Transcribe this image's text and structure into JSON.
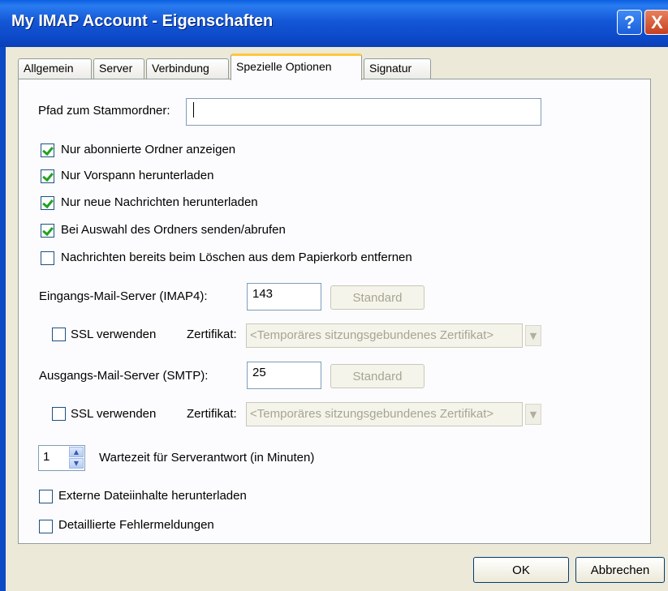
{
  "window": {
    "title": "My IMAP Account - Eigenschaften",
    "help_label": "?",
    "close_label": "X"
  },
  "tabs": [
    {
      "label": "Allgemein"
    },
    {
      "label": "Server"
    },
    {
      "label": "Verbindung"
    },
    {
      "label": "Spezielle Optionen"
    },
    {
      "label": "Signatur"
    }
  ],
  "root_folder": {
    "label": "Pfad zum Stammordner:",
    "value": ""
  },
  "checkboxes": [
    {
      "label": "Nur abonnierte Ordner anzeigen",
      "checked": true
    },
    {
      "label": "Nur Vorspann herunterladen",
      "checked": true
    },
    {
      "label": "Nur neue Nachrichten herunterladen",
      "checked": true
    },
    {
      "label": "Bei Auswahl des Ordners senden/abrufen",
      "checked": true
    },
    {
      "label": "Nachrichten bereits beim Löschen aus dem Papierkorb entfernen",
      "checked": false
    }
  ],
  "incoming": {
    "label": "Eingangs-Mail-Server (IMAP4):",
    "port": "143",
    "standard_label": "Standard",
    "ssl_label": "SSL verwenden",
    "ssl_checked": false,
    "cert_label": "Zertifikat:",
    "cert_value": "<Temporäres sitzungsgebundenes Zertifikat>"
  },
  "outgoing": {
    "label": "Ausgangs-Mail-Server (SMTP):",
    "port": "25",
    "standard_label": "Standard",
    "ssl_label": "SSL verwenden",
    "ssl_checked": false,
    "cert_label": "Zertifikat:",
    "cert_value": "<Temporäres sitzungsgebundenes Zertifikat>"
  },
  "timeout": {
    "value": "1",
    "label": "Wartezeit für Serverantwort (in Minuten)"
  },
  "extra_checkboxes": [
    {
      "label": "Externe Dateiinhalte herunterladen",
      "checked": false
    },
    {
      "label": "Detaillierte Fehlermeldungen",
      "checked": false
    }
  ],
  "footer": {
    "ok_label": "OK",
    "cancel_label": "Abbrechen"
  },
  "colors": {
    "title_bar": "#0c49c8",
    "active_tab_accent": "#ffc83c",
    "check_mark": "#21a121"
  }
}
